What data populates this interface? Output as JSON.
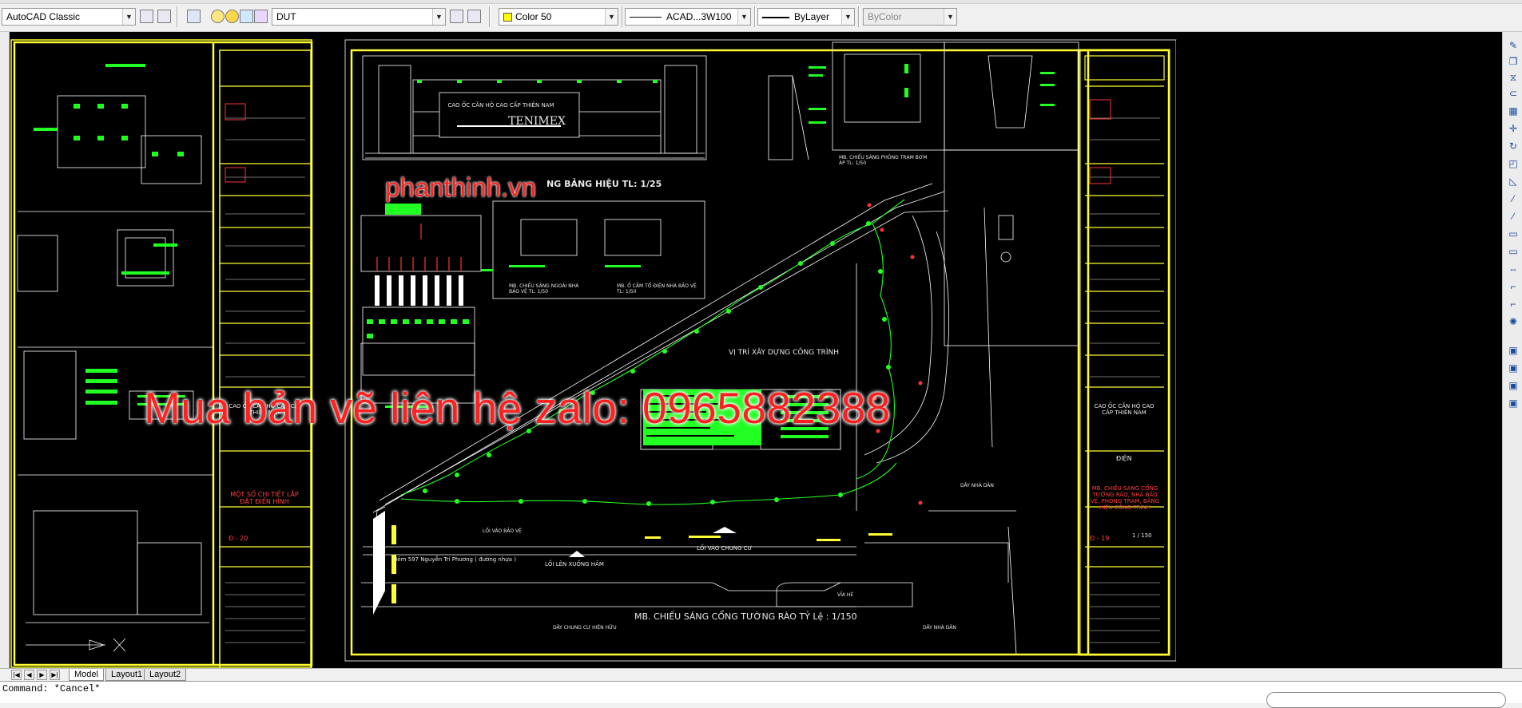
{
  "toolbar": {
    "workspace": "AutoCAD Classic",
    "layer": "DUT",
    "color": "Color 50",
    "color_hex": "#ffff00",
    "linetype": "ACAD...3W100",
    "lineweight": "ByLayer",
    "plotstyle": "ByColor"
  },
  "drawing": {
    "site_watermark": "phanthinh.vn",
    "contact_watermark": "Mua bản vẽ liên hệ zalo: 0965882388",
    "gate_title": "TENIMEX",
    "gate_subtitle": "CAO ỐC CĂN HỘ CAO CẤP THIÊN NAM",
    "sign_title": "NG BẢNG HIỆU TL: 1/25",
    "site_label": "VỊ TRÍ XÂY DỰNG CÔNG TRÌNH",
    "main_caption": "MB. CHIẾU SÁNG CỔNG TƯỜNG RÀO TỶ Lệ : 1/150",
    "detail_caption_1": "MB. CHIẾU SÁNG NGOÀI NHÀ BẢO VỆ  TL: 1/50",
    "detail_caption_2": "MB. Ổ CẮM TỔ ĐIỆN NHÀ BẢO VỆ TL: 1/50",
    "detail_caption_3": "MB. CHIẾU SÁNG PHÒNG TRẠM BƠM ÁP  TL: 1/50",
    "road_label": "Hẻm 597 Nguyễn Tri Phương  ( đường nhựa )",
    "entry_label": "LỐI LÊN XUỐNG HẦM",
    "entry_label_2": "LỐI VÀO CHUNG CƯ",
    "entry_label_3": "LỐI VÀO BẢO VỆ",
    "sidewalk": "VỈA HÈ",
    "neighbor_left": "DÃY CHUNG CƯ HIỆN HỮU",
    "neighbor_right": "DÃY NHÀ DÂN",
    "neighbor_right_2": "DÃY NHÀ DÂN",
    "title_project_left": "CAO ỐC CĂN HỘ CAO CẤP THIÊN NAM",
    "title_sheet_left": "MỘT SỐ CHI TIẾT LẮP ĐẶT ĐIỂN HÌNH",
    "sheet_no_left": "Đ - 20",
    "title_project_right": "CAO ỐC CĂN HỘ CAO CẤP THIÊN NAM",
    "title_discipline_right": "ĐIỆN",
    "title_sheet_right": "MB. CHIẾU SÁNG CỔNG TƯỜNG RÀO, NHÀ BẢO VỆ, PHÒNG TRẠM, BẢNG HIỆU CÔNG TRÌNH",
    "sheet_no_right": "Đ - 19",
    "scale_right": "1 / 150"
  },
  "tabs": [
    "Model",
    "Layout1",
    "Layout2"
  ],
  "command": {
    "text": "Command: *Cancel*"
  }
}
